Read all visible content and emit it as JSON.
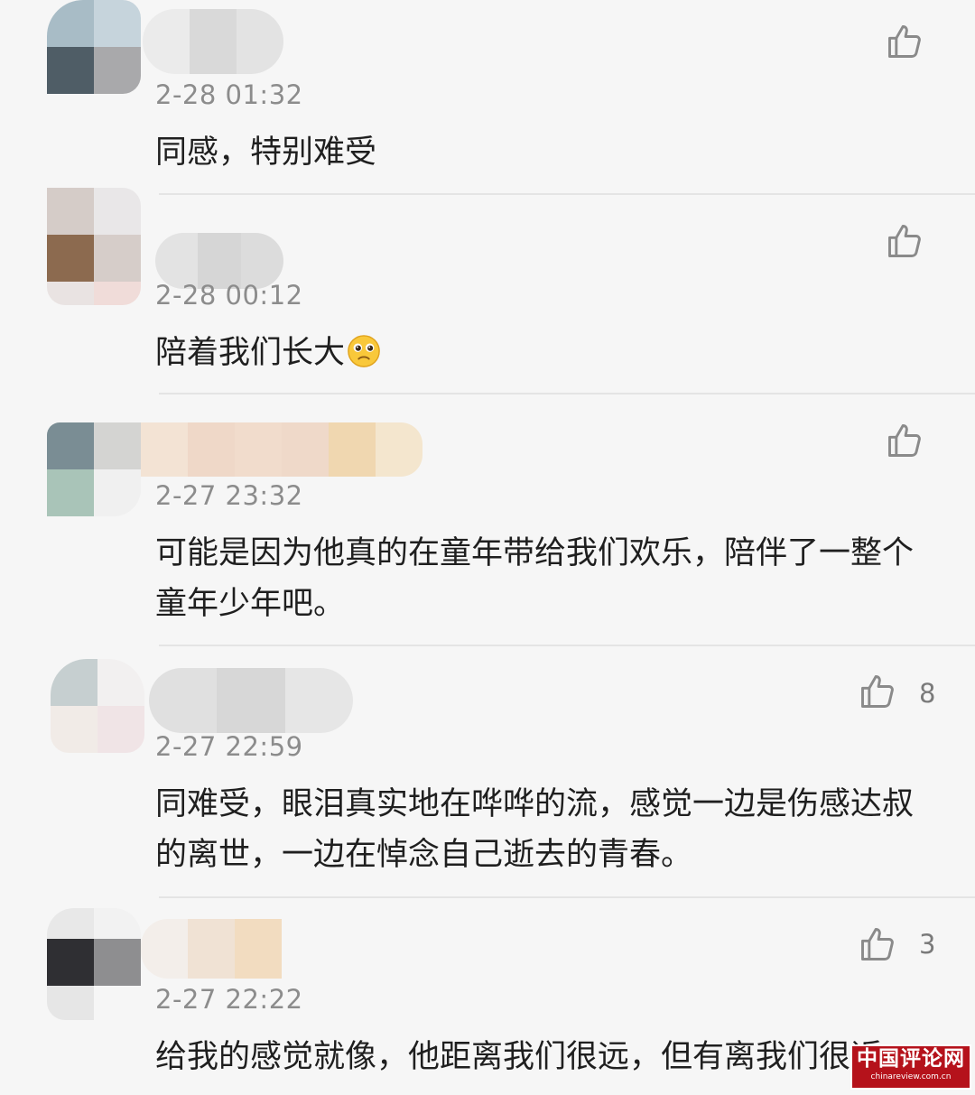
{
  "comments": [
    {
      "time": "2-28 01:32",
      "text": "同感，特别难受",
      "likes": ""
    },
    {
      "time": "2-28 00:12",
      "text": "陪着我们长大",
      "likes": ""
    },
    {
      "time": "2-27 23:32",
      "text": "可能是因为他真的在童年带给我们欢乐，陪伴了一整个童年少年吧。",
      "likes": ""
    },
    {
      "time": "2-27 22:59",
      "text": "同难受，眼泪真实地在哗哗的流，感觉一边是伤感达叔的离世，一边在悼念自己逝去的青春。",
      "likes": "8"
    },
    {
      "time": "2-27 22:22",
      "text": "给我的感觉就像，他距离我们很远，但有离我们很近",
      "likes": "3"
    }
  ],
  "icons": {
    "like": "thumbs-up-icon",
    "emoji": "pleading-face-emoji"
  },
  "watermark": {
    "title": "中国评论网",
    "url": "chinareview.com.cn"
  },
  "colors": {
    "background": "#f6f6f6",
    "text": "#1f1f1f",
    "meta": "#8c8c8c",
    "watermark": "#b5121b"
  }
}
